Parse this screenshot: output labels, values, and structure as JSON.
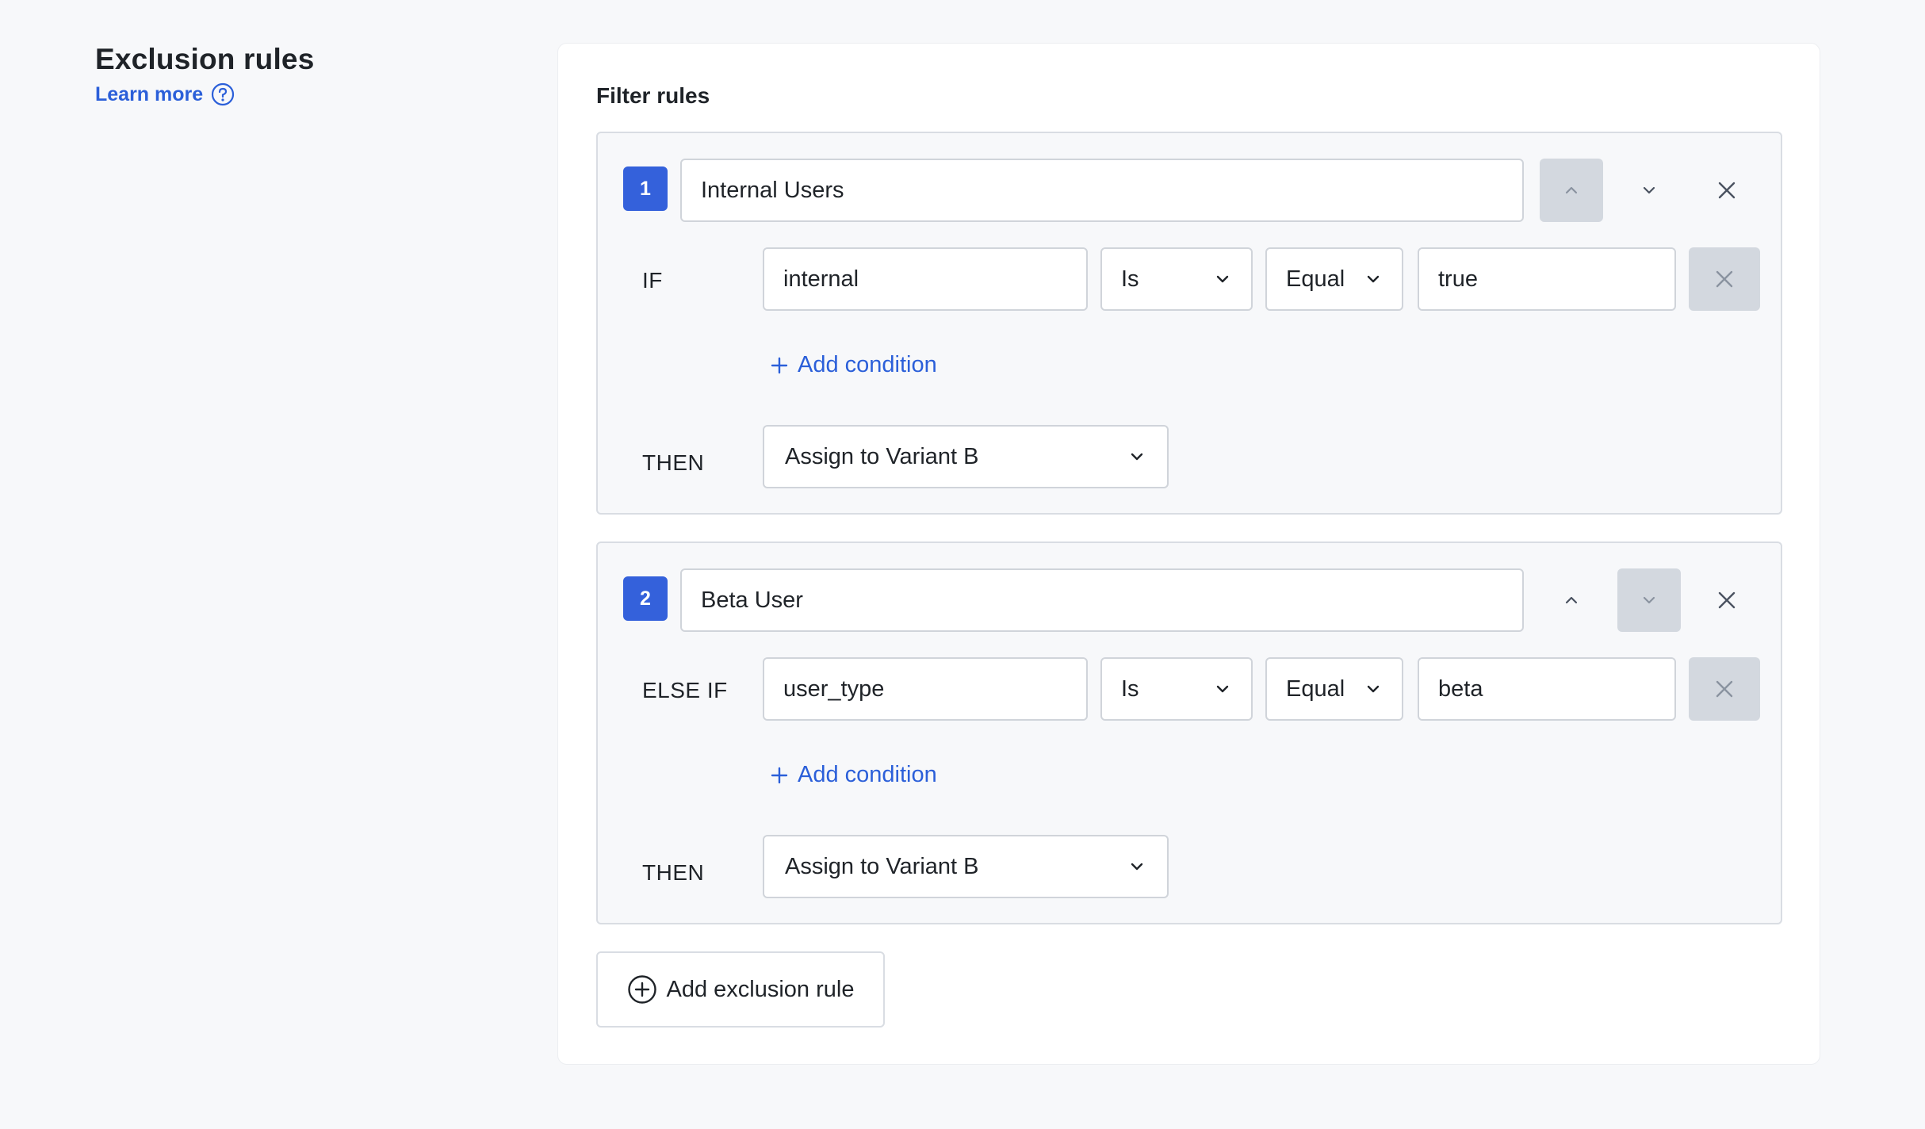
{
  "sidebar": {
    "title": "Exclusion rules",
    "learn_more": "Learn more"
  },
  "card": {
    "title": "Filter rules",
    "add_rule_label": "Add exclusion rule",
    "rules": [
      {
        "number": "1",
        "name": "Internal Users",
        "condition_label": "IF",
        "attribute": "internal",
        "operator": "Is",
        "comparator": "Equal",
        "value": "true",
        "add_condition_label": "Add condition",
        "then_label": "THEN",
        "action": "Assign to Variant B",
        "move_up_disabled": true,
        "move_down_disabled": false
      },
      {
        "number": "2",
        "name": "Beta User",
        "condition_label": "ELSE IF",
        "attribute": "user_type",
        "operator": "Is",
        "comparator": "Equal",
        "value": "beta",
        "add_condition_label": "Add condition",
        "then_label": "THEN",
        "action": "Assign to Variant B",
        "move_up_disabled": false,
        "move_down_disabled": true
      }
    ]
  },
  "icons": {
    "help": "help-circle-icon",
    "chevron_up": "chevron-up-icon",
    "chevron_down": "chevron-down-icon",
    "close": "close-icon",
    "plus": "plus-icon",
    "plus_circle": "plus-circle-icon"
  },
  "colors": {
    "accent": "#3461db",
    "link": "#2b5fd9",
    "disabled_bg": "#d3d8df",
    "page_bg": "#f7f8fa"
  }
}
